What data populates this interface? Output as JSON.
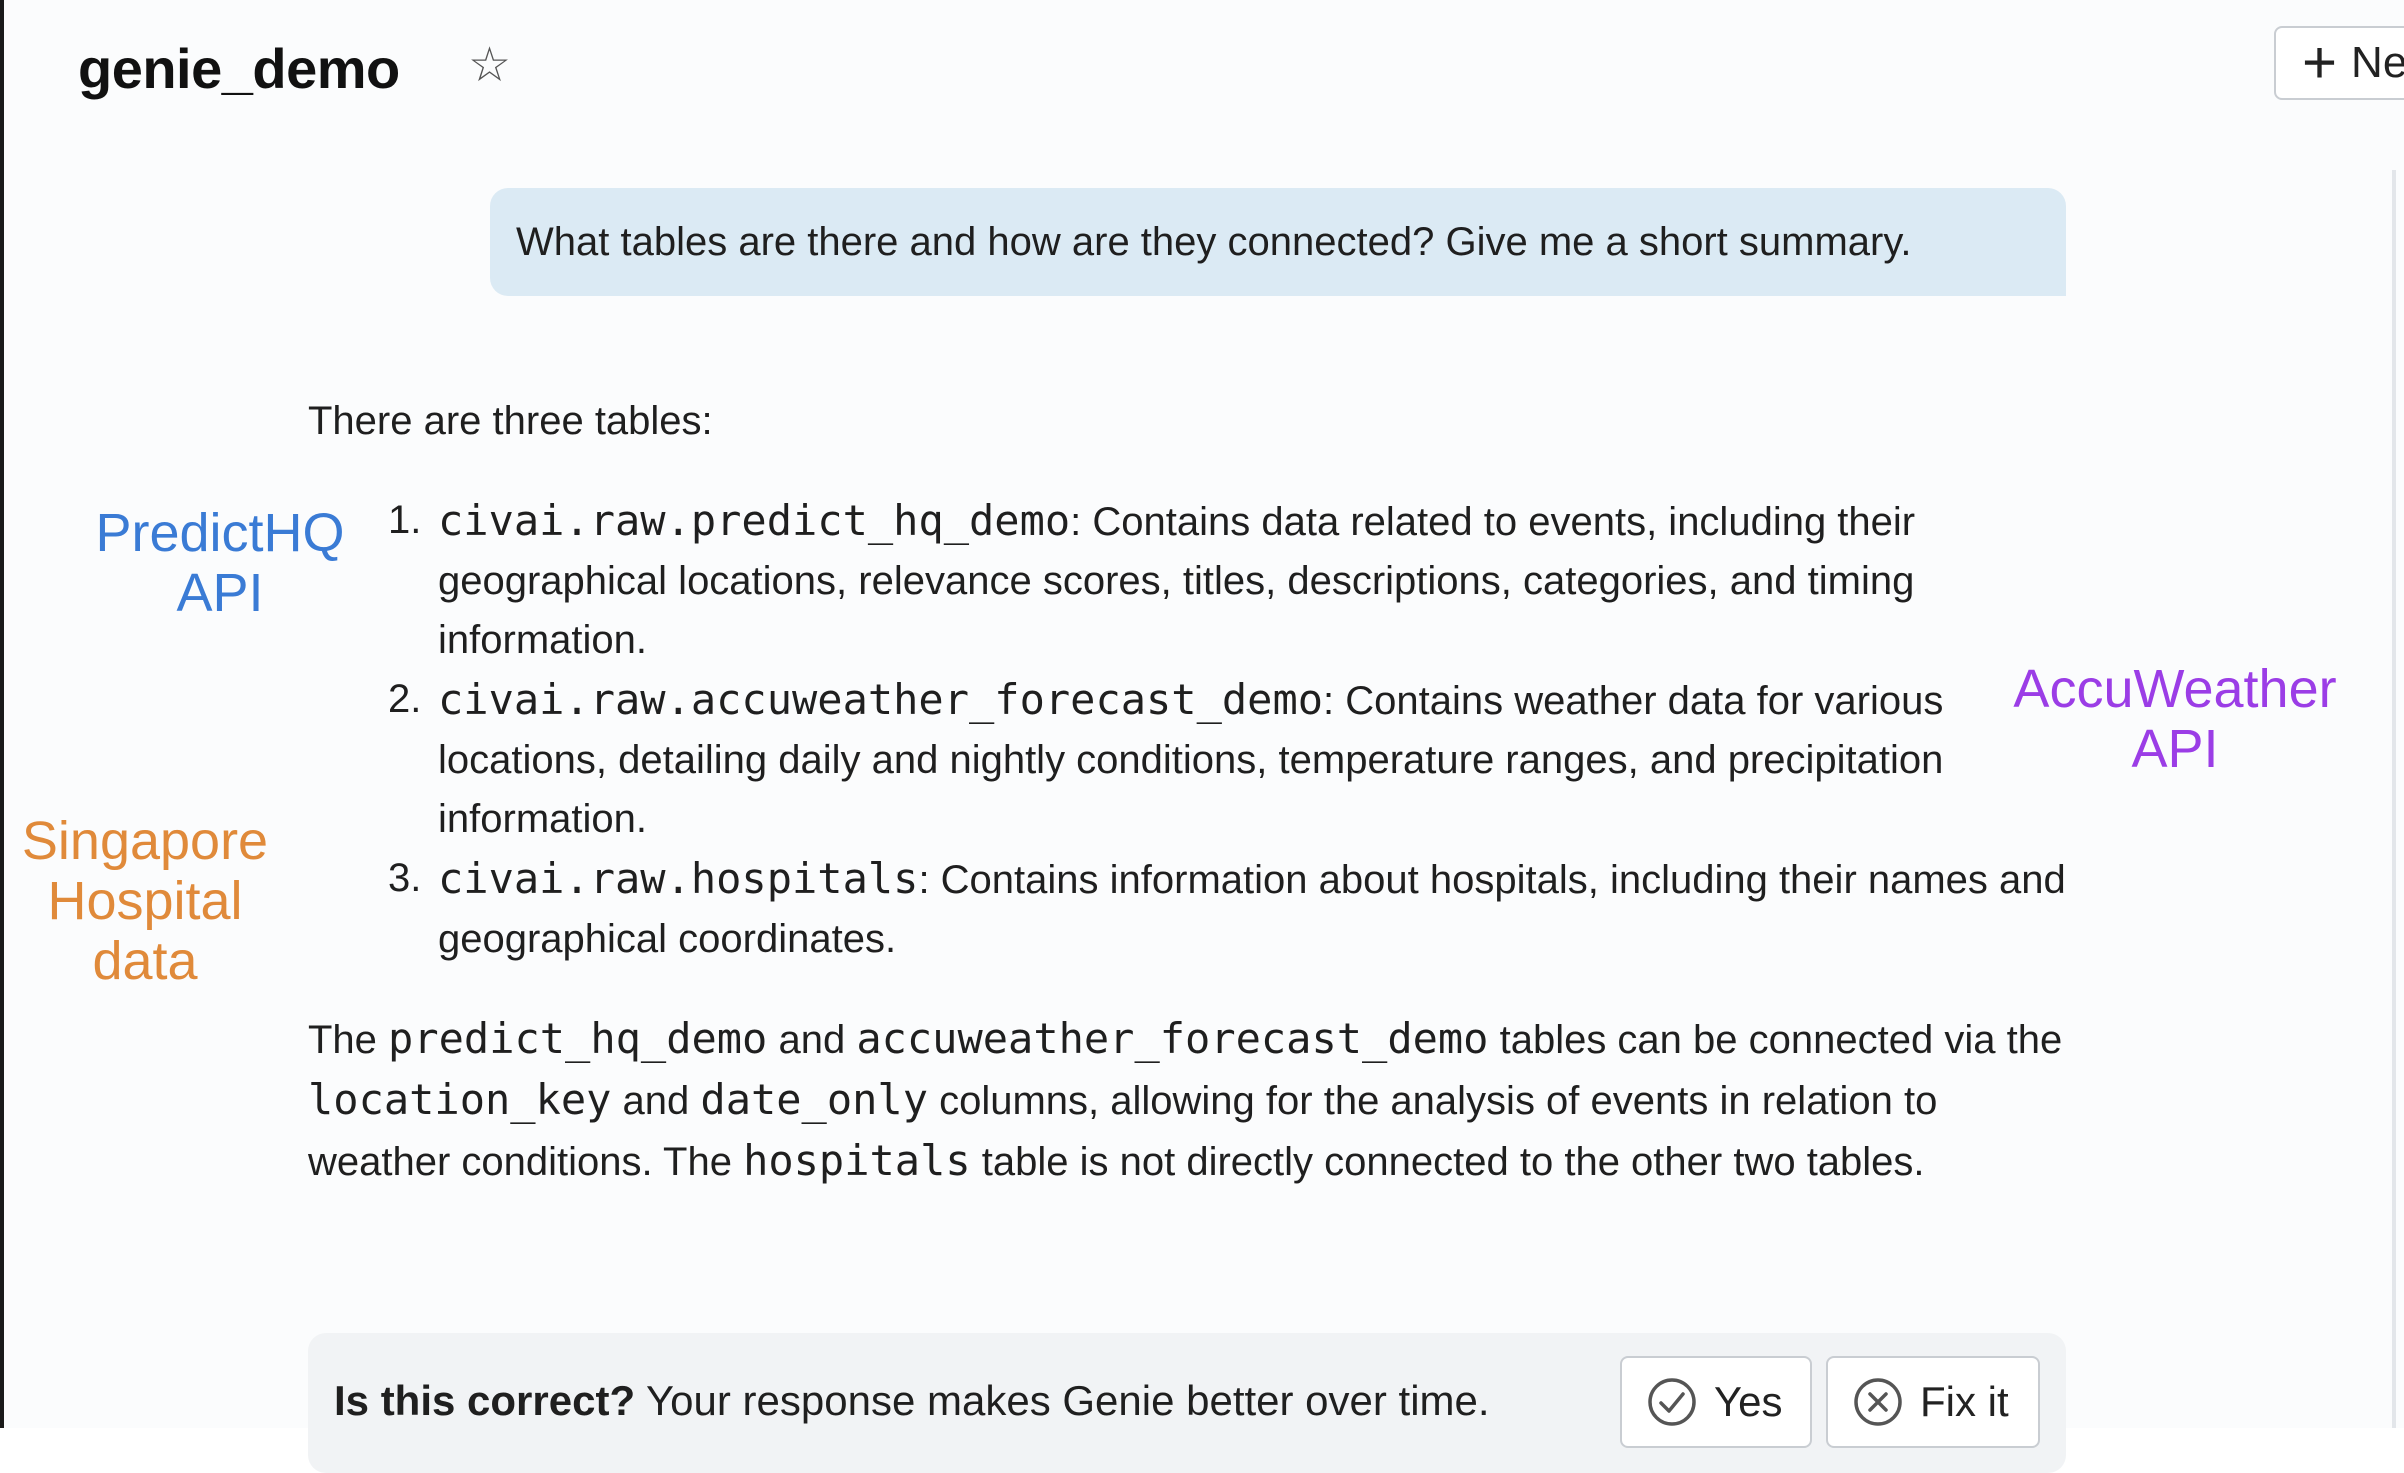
{
  "header": {
    "title": "genie_demo",
    "new_button_label": "Ne",
    "icons": [
      "star-icon",
      "plus-icon"
    ]
  },
  "question": "What tables are there and how are they connected? Give me a short summary.",
  "answer": {
    "intro": "There are three tables:",
    "items": [
      {
        "num": "1.",
        "code": "civai.raw.predict_hq_demo",
        "text": ": Contains data related to events, including their geographical locations, relevance scores, titles, descriptions, categories, and timing information."
      },
      {
        "num": "2.",
        "code": "civai.raw.accuweather_forecast_demo",
        "text": ": Contains weather data for various locations, detailing daily and nightly conditions, temperature ranges, and precipitation information."
      },
      {
        "num": "3.",
        "code": "civai.raw.hospitals",
        "text": ": Contains information about hospitals, including their names and geographical coordinates."
      }
    ],
    "summary": {
      "p1": "The ",
      "c1": "predict_hq_demo",
      "p2": " and ",
      "c2": "accuweather_forecast_demo",
      "p3": " tables can be connected via the ",
      "c3": "location_key",
      "p4": " and ",
      "c4": "date_only",
      "p5": " columns, allowing for the analysis of events in relation to weather conditions. The ",
      "c5": "hospitals",
      "p6": " table is not directly connected to the other two tables."
    }
  },
  "annotations": {
    "predicthq": {
      "line1": "PredictHQ",
      "line2": "API",
      "color": "#3a7bd5"
    },
    "accuweather": {
      "line1": "AccuWeather",
      "line2": "API",
      "color": "#9b3de6"
    },
    "singapore": {
      "line1": "Singapore",
      "line2": "Hospital",
      "line3": "data",
      "color": "#e08a3a"
    }
  },
  "feedback": {
    "bold": "Is this correct?",
    "text": " Your response makes Genie better over time.",
    "yes_label": "Yes",
    "fix_label": "Fix it",
    "icons": [
      "check-circle-icon",
      "x-circle-icon"
    ]
  }
}
